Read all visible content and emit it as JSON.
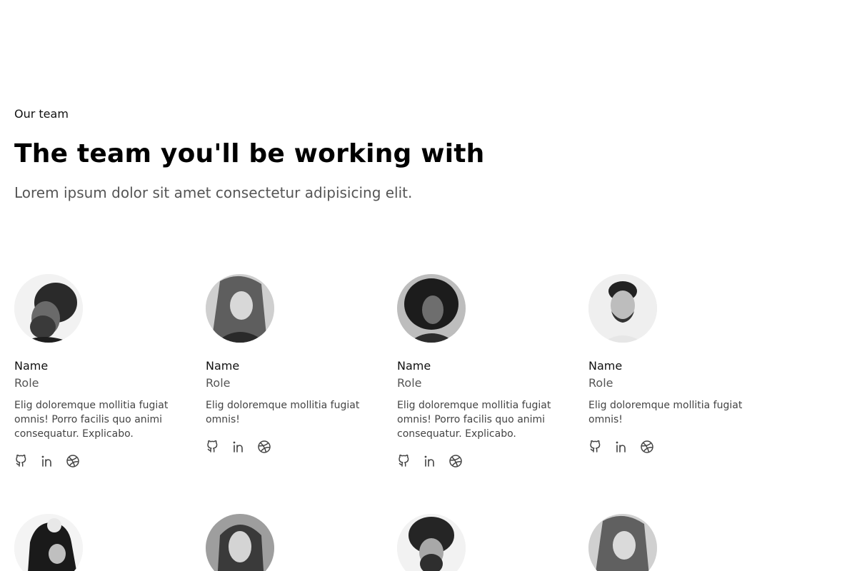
{
  "header": {
    "eyebrow": "Our team",
    "title": "The team you'll be working with",
    "subtitle": "Lorem ipsum dolor sit amet consectetur adipisicing elit."
  },
  "members": [
    {
      "name": "Name",
      "role": "Role",
      "bio": "Elig doloremque mollitia fugiat omnis! Porro facilis quo animi consequatur. Explicabo.",
      "photo": "curly-hair-bearded-man-profile"
    },
    {
      "name": "Name",
      "role": "Role",
      "bio": "Elig doloremque mollitia fugiat omnis!",
      "photo": "woman-long-hair-looking-up"
    },
    {
      "name": "Name",
      "role": "Role",
      "bio": "Elig doloremque mollitia fugiat omnis! Porro facilis quo animi consequatur. Explicabo.",
      "photo": "woman-curly-hair"
    },
    {
      "name": "Name",
      "role": "Role",
      "bio": "Elig doloremque mollitia fugiat omnis!",
      "photo": "man-short-hair-beard"
    },
    {
      "name": "",
      "role": "",
      "bio": "",
      "photo": "person-hoodie-hand-on-head"
    },
    {
      "name": "",
      "role": "",
      "bio": "",
      "photo": "woman-long-straight-hair"
    },
    {
      "name": "",
      "role": "",
      "bio": "",
      "photo": "curly-hair-bearded-man"
    },
    {
      "name": "",
      "role": "",
      "bio": "",
      "photo": "woman-long-hair-looking-up"
    }
  ],
  "social_icons": [
    "github-icon",
    "linkedin-icon",
    "dribbble-icon"
  ],
  "colors": {
    "heading": "#000000",
    "muted": "#555555",
    "icon": "#444444"
  }
}
